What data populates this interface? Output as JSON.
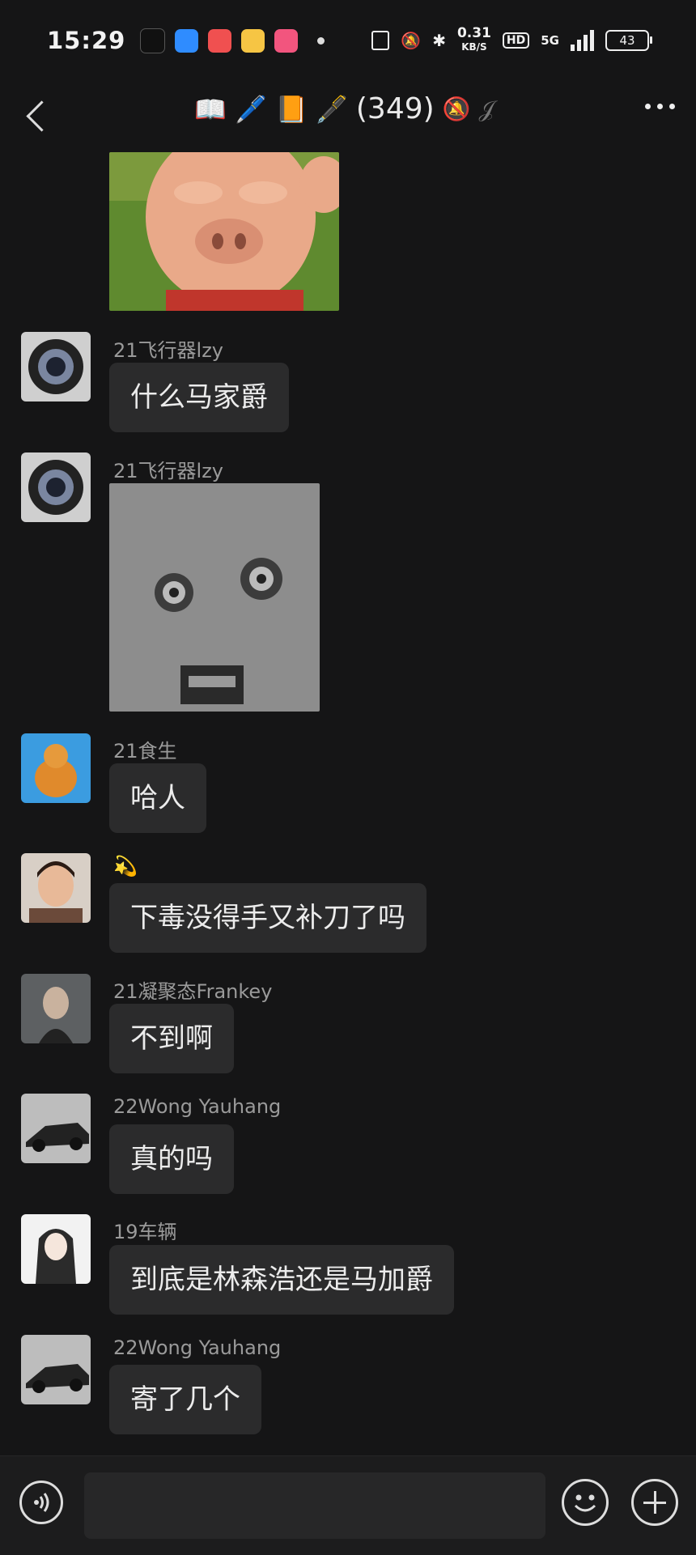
{
  "status_bar": {
    "time": "15:29",
    "net_speed_value": "0.31",
    "net_speed_unit": "KB/S",
    "hd": "HD",
    "network": "5G",
    "battery": "43"
  },
  "header": {
    "title_emojis": "📖 🖊️ 📙 🖋️",
    "member_count": "(349)"
  },
  "messages": [
    {
      "type": "image",
      "sender": "",
      "image": "pig-sticker"
    },
    {
      "type": "text",
      "sender": "21飞行器lzy",
      "avatar": "lens-avatar",
      "text": "什么马家爵"
    },
    {
      "type": "image",
      "sender": "21飞行器lzy",
      "avatar": "lens-avatar",
      "image": "socket-face-sticker"
    },
    {
      "type": "text",
      "sender": "21食生",
      "avatar": "cat-avatar",
      "text": "哈人"
    },
    {
      "type": "text",
      "sender": "💫",
      "avatar": "boy-avatar",
      "text": "下毒没得手又补刀了吗"
    },
    {
      "type": "text",
      "sender": "21凝聚态Frankey",
      "avatar": "person-avatar",
      "text": "不到啊"
    },
    {
      "type": "text",
      "sender": "22Wong Yauhang",
      "avatar": "car-avatar",
      "text": "真的吗"
    },
    {
      "type": "text",
      "sender": "19车辆",
      "avatar": "anime-avatar",
      "text": "到底是林森浩还是马加爵"
    },
    {
      "type": "text",
      "sender": "22Wong Yauhang",
      "avatar": "car-avatar",
      "text": "寄了几个"
    }
  ],
  "input": {
    "placeholder": ""
  },
  "colors": {
    "background": "#151516",
    "bubble": "#2b2b2c",
    "sender_text": "#9a9a9a"
  }
}
